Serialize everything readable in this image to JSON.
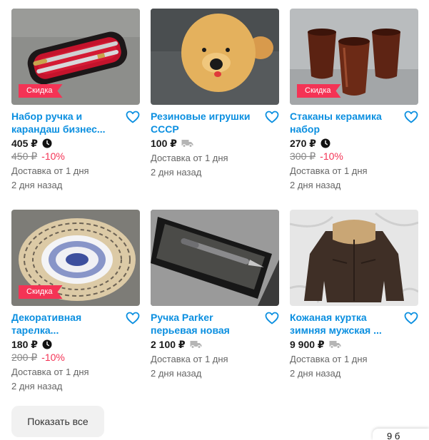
{
  "listings": [
    {
      "title": "Набор ручка и карандаш бизнес...",
      "price": "405 ₽",
      "price_icon": "clock-icon",
      "old_price": "450 ₽",
      "discount": "-10%",
      "badge": "Скидка",
      "delivery": "Доставка от 1 дня",
      "posted": "2 дня назад"
    },
    {
      "title": "Резиновые игрушки СССР",
      "price": "100 ₽",
      "price_icon": "truck-icon",
      "old_price": "",
      "discount": "",
      "badge": "",
      "delivery": "Доставка от 1 дня",
      "posted": "2 дня назад"
    },
    {
      "title": "Стаканы керамика набор",
      "price": "270 ₽",
      "price_icon": "clock-icon",
      "old_price": "300 ₽",
      "discount": "-10%",
      "badge": "Скидка",
      "delivery": "Доставка от 1 дня",
      "posted": "2 дня назад"
    },
    {
      "title": "Декоративная тарелка...",
      "price": "180 ₽",
      "price_icon": "clock-icon",
      "old_price": "200 ₽",
      "discount": "-10%",
      "badge": "Скидка",
      "delivery": "Доставка от 1 дня",
      "posted": "2 дня назад"
    },
    {
      "title": "Ручка Parker перьевая новая",
      "price": "2 100 ₽",
      "price_icon": "truck-icon",
      "old_price": "",
      "discount": "",
      "badge": "",
      "delivery": "Доставка от 1 дня",
      "posted": "2 дня назад"
    },
    {
      "title": "Кожаная куртка зимняя мужская ...",
      "price": "9 900 ₽",
      "price_icon": "truck-icon",
      "old_price": "",
      "discount": "",
      "badge": "",
      "delivery": "Доставка от 1 дня",
      "posted": "2 дня назад"
    }
  ],
  "show_all_label": "Показать все",
  "corner_chip_text": "9 б",
  "colors": {
    "title": "#0b8fe0",
    "discount": "#f43355",
    "badge": "#f43355",
    "button_bg": "#f1f1f1"
  }
}
